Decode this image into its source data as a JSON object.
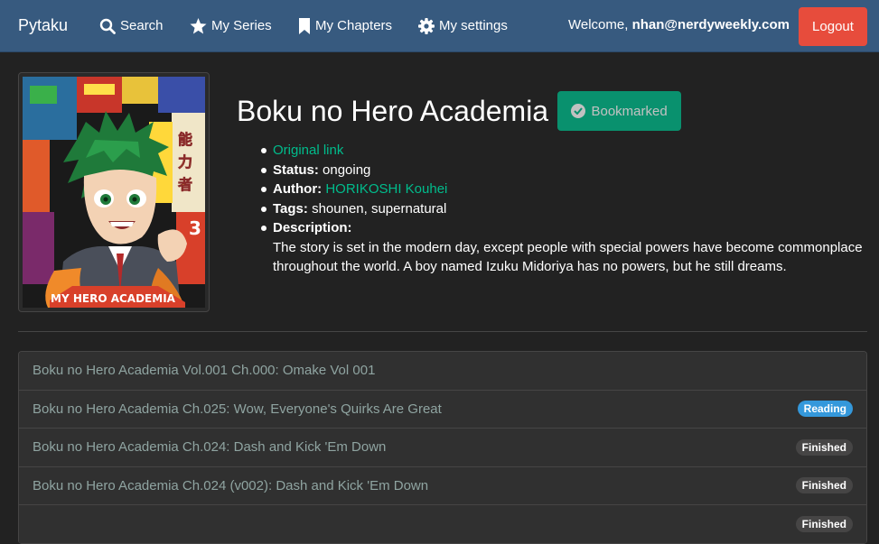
{
  "nav": {
    "brand": "Pytaku",
    "links": [
      {
        "label": "Search",
        "icon": "search-icon"
      },
      {
        "label": "My Series",
        "icon": "star-icon"
      },
      {
        "label": "My Chapters",
        "icon": "bookmark-icon"
      },
      {
        "label": "My settings",
        "icon": "gear-icon"
      }
    ],
    "welcome_prefix": "Welcome,",
    "user_email": "nhan@nerdyweekly.com",
    "logout_label": "Logout"
  },
  "colors": {
    "navbar": "#375a7f",
    "background": "#222222",
    "accent": "#00bc8c",
    "danger": "#e74c3c",
    "reading_badge": "#3498db",
    "finished_badge": "#464545"
  },
  "series": {
    "cover_image": "manga cover art",
    "cover_text": "MY HERO ACADEMIA",
    "title": "Boku no Hero Academia",
    "bookmark_label": "Bookmarked",
    "original_link_label": "Original link",
    "status_label": "Status:",
    "status_value": "ongoing",
    "author_label": "Author:",
    "author_value": "HORIKOSHI Kouhei",
    "tags_label": "Tags:",
    "tags_value": "shounen, supernatural",
    "description_label": "Description:",
    "description_value": "The story is set in the modern day, except people with special powers have become commonplace throughout the world. A boy named Izuku Midoriya has no powers, but he still dreams."
  },
  "chapters": [
    {
      "title": "Boku no Hero Academia Vol.001 Ch.000: Omake Vol 001",
      "badge": ""
    },
    {
      "title": "Boku no Hero Academia Ch.025: Wow, Everyone's Quirks Are Great",
      "badge": "Reading"
    },
    {
      "title": "Boku no Hero Academia Ch.024: Dash and Kick 'Em Down",
      "badge": "Finished"
    },
    {
      "title": "Boku no Hero Academia Ch.024 (v002): Dash and Kick 'Em Down",
      "badge": "Finished"
    },
    {
      "title": "",
      "badge": "Finished"
    }
  ]
}
